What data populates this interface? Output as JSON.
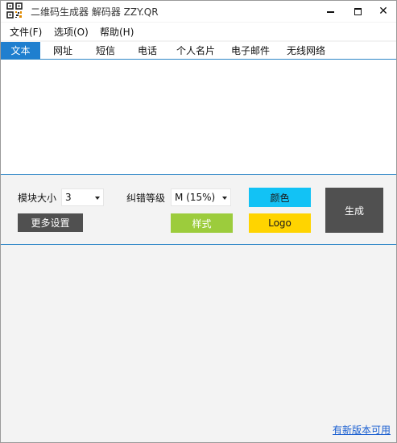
{
  "window": {
    "title": "二维码生成器 解码器 ZZY.QR",
    "icon": "qr-code-icon",
    "controls": {
      "minimize": "minimize-icon",
      "maximize": "maximize-icon",
      "close_glyph": "✕"
    }
  },
  "menu": {
    "items": [
      {
        "label": "文件(F)"
      },
      {
        "label": "选项(O)"
      },
      {
        "label": "帮助(H)"
      }
    ]
  },
  "tabs": {
    "items": [
      {
        "label": "文本",
        "active": true
      },
      {
        "label": "网址"
      },
      {
        "label": "短信"
      },
      {
        "label": "电话"
      },
      {
        "label": "个人名片"
      },
      {
        "label": "电子邮件"
      },
      {
        "label": "无线网络"
      }
    ]
  },
  "text_input": {
    "value": ""
  },
  "controls": {
    "module_size_label": "模块大小",
    "module_size_value": "3",
    "error_level_label": "纠错等级",
    "error_level_value": "M (15%)",
    "more_settings_label": "更多设置",
    "color_label": "颜色",
    "style_label": "样式",
    "logo_label": "Logo",
    "generate_label": "生成"
  },
  "footer": {
    "update_link": "有新版本可用"
  },
  "colors": {
    "accent": "#1f7fcf",
    "color_button": "#12c2f5",
    "style_button": "#9ccc3c",
    "logo_button": "#ffd400",
    "dark_button": "#505050",
    "link": "#1a5fd1"
  }
}
